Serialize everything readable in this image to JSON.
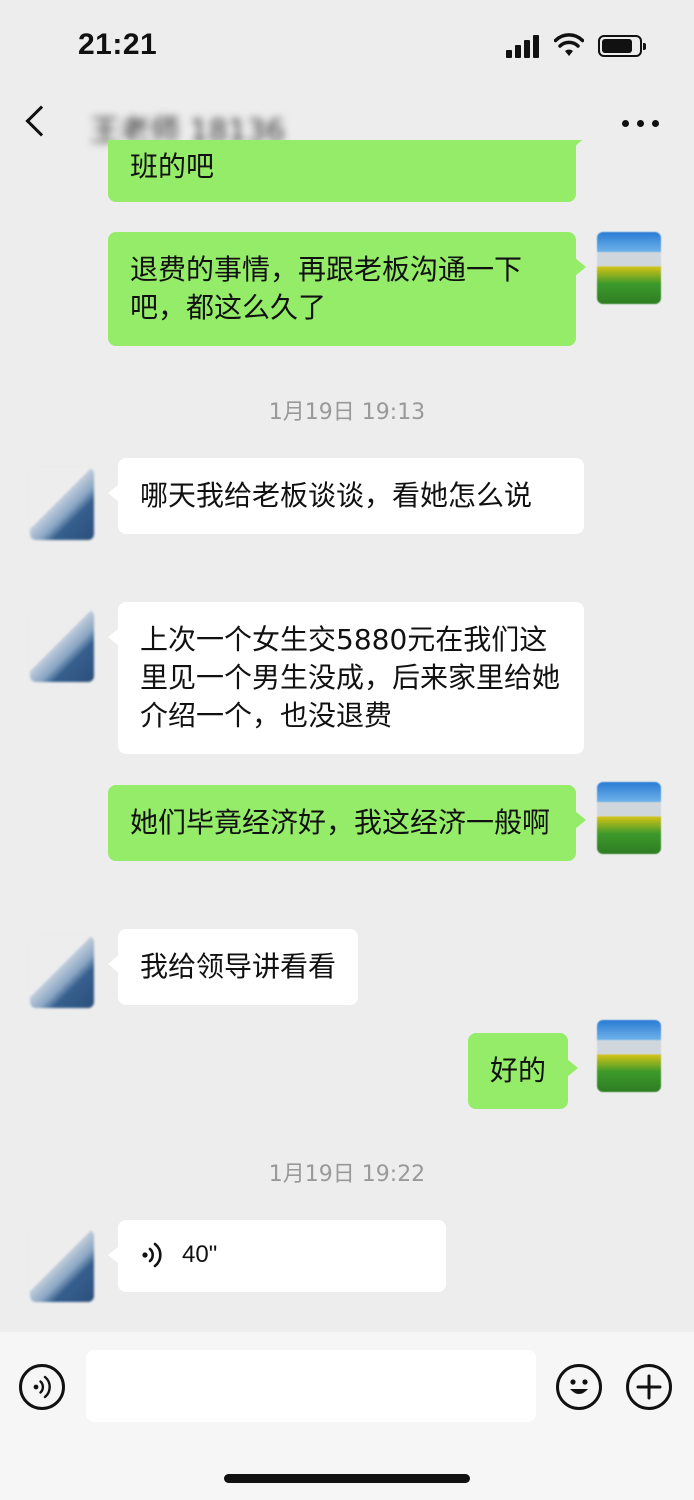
{
  "status_bar": {
    "time": "21:21"
  },
  "nav": {
    "title": "王老师 18136"
  },
  "messages": {
    "m0": "班的吧",
    "m1": "退费的事情，再跟老板沟通一下吧，都这么久了",
    "ts1": "1月19日 19:13",
    "m2": "哪天我给老板谈谈，看她怎么说",
    "m3": "上次一个女生交5880元在我们这里见一个男生没成，后来家里给她介绍一个，也没退费",
    "m4": "她们毕竟经济好，我这经济一般啊",
    "m5": "我给领导讲看看",
    "m6": "好的",
    "ts2": "1月19日 19:22",
    "voice_duration": "40\""
  },
  "colors": {
    "outgoing_bubble": "#95ec69",
    "incoming_bubble": "#ffffff",
    "background": "#ededed"
  },
  "icons": [
    "back-icon",
    "more-icon",
    "voice-wave-icon",
    "voice-input-icon",
    "emoji-icon",
    "add-icon"
  ]
}
